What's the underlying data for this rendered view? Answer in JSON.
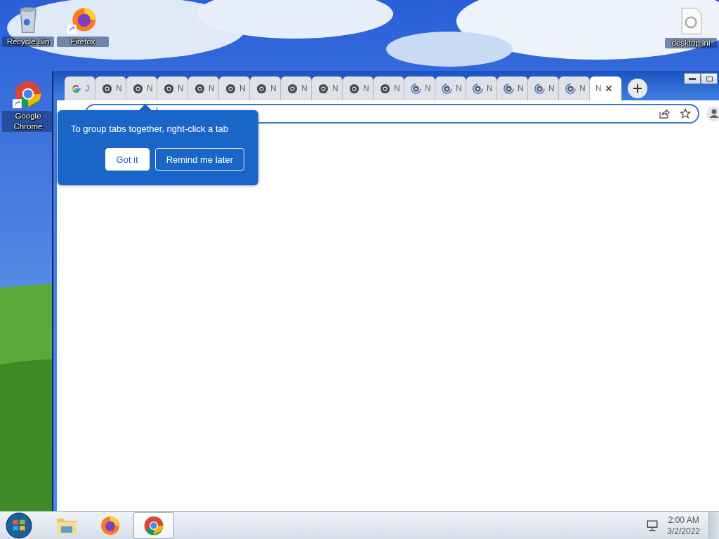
{
  "desktop_icons": [
    {
      "label": "Recycle Bin",
      "kind": "recycle",
      "shortcut": false
    },
    {
      "label": "Firefox",
      "kind": "firefox",
      "shortcut": true
    },
    {
      "label": "desktop.ini",
      "kind": "file",
      "shortcut": false
    },
    {
      "label": "Google Chrome",
      "kind": "chrome",
      "shortcut": true
    }
  ],
  "browser": {
    "tabs": [
      {
        "title": "J",
        "kind": "google",
        "selected": false
      },
      {
        "title": "N",
        "kind": "chrome",
        "selected": false
      },
      {
        "title": "N",
        "kind": "chrome",
        "selected": false
      },
      {
        "title": "N",
        "kind": "chrome",
        "selected": false
      },
      {
        "title": "N",
        "kind": "chrome",
        "selected": false
      },
      {
        "title": "N",
        "kind": "chrome",
        "selected": false
      },
      {
        "title": "N",
        "kind": "chrome",
        "selected": false
      },
      {
        "title": "N",
        "kind": "chrome",
        "selected": false
      },
      {
        "title": "N",
        "kind": "chrome",
        "selected": false
      },
      {
        "title": "N",
        "kind": "chrome",
        "selected": false
      },
      {
        "title": "N",
        "kind": "chrome",
        "selected": false
      },
      {
        "title": "N",
        "kind": "loading",
        "selected": false
      },
      {
        "title": "N",
        "kind": "loading",
        "selected": false
      },
      {
        "title": "N",
        "kind": "loading",
        "selected": false
      },
      {
        "title": "N",
        "kind": "loading",
        "selected": false
      },
      {
        "title": "N",
        "kind": "loading",
        "selected": false
      },
      {
        "title": "N",
        "kind": "loading",
        "selected": false
      },
      {
        "title": "N",
        "kind": "none",
        "selected": true
      }
    ],
    "callout": {
      "text": "To group tabs together, right-click a tab",
      "buttons": [
        {
          "label": "Got it",
          "kind": "primary"
        },
        {
          "label": "Remind me later",
          "kind": "secondary"
        }
      ]
    }
  },
  "taskbar": {
    "apps": [
      {
        "kind": "explorer",
        "selected": false
      },
      {
        "kind": "firefox",
        "selected": false
      },
      {
        "kind": "chrome",
        "selected": true
      }
    ],
    "time": "2:00 AM",
    "date": "3/2/2022"
  }
}
